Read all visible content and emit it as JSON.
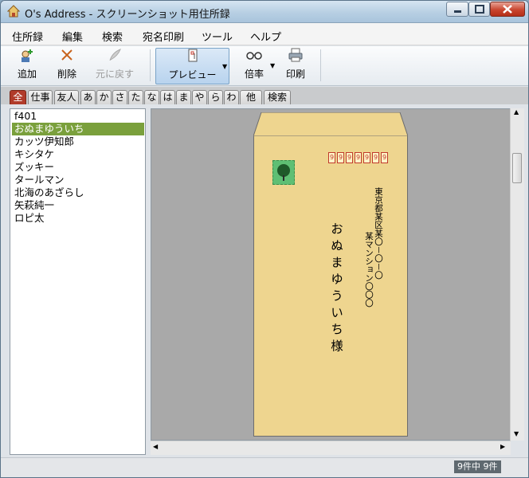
{
  "window": {
    "title": "O's Address - スクリーンショット用住所録"
  },
  "menu": [
    "住所録",
    "編集",
    "検索",
    "宛名印刷",
    "ツール",
    "ヘルプ"
  ],
  "toolbar": {
    "add_label": "追加",
    "delete_label": "削除",
    "undo_label": "元に戻す",
    "preview_label": "プレビュー",
    "zoom_label": "倍率",
    "print_label": "印刷"
  },
  "tabs": [
    "全",
    "仕事",
    "友人",
    "あ",
    "か",
    "さ",
    "た",
    "な",
    "は",
    "ま",
    "や",
    "ら",
    "わ",
    "他",
    "検索"
  ],
  "list": {
    "items": [
      "f401",
      "おぬまゆういち",
      "カッツ伊知郎",
      "キシタケ",
      "ズッキー",
      "タールマン",
      "北海のあざらし",
      "矢萩純一",
      "ロピ太"
    ],
    "selected_index": 1
  },
  "envelope": {
    "postal_boxes": [
      "9",
      "9",
      "9",
      "9",
      "9",
      "9",
      "9"
    ],
    "address_line1": "東京都某区某〇－〇－〇",
    "address_line2": "某マンション〇〇〇",
    "recipient": "おぬまゆういち様"
  },
  "status": {
    "count": "9件中 9件"
  },
  "colors": {
    "selected": "#7aa03c",
    "envelope": "#eed58f",
    "tab_active": "#b13b2a"
  }
}
